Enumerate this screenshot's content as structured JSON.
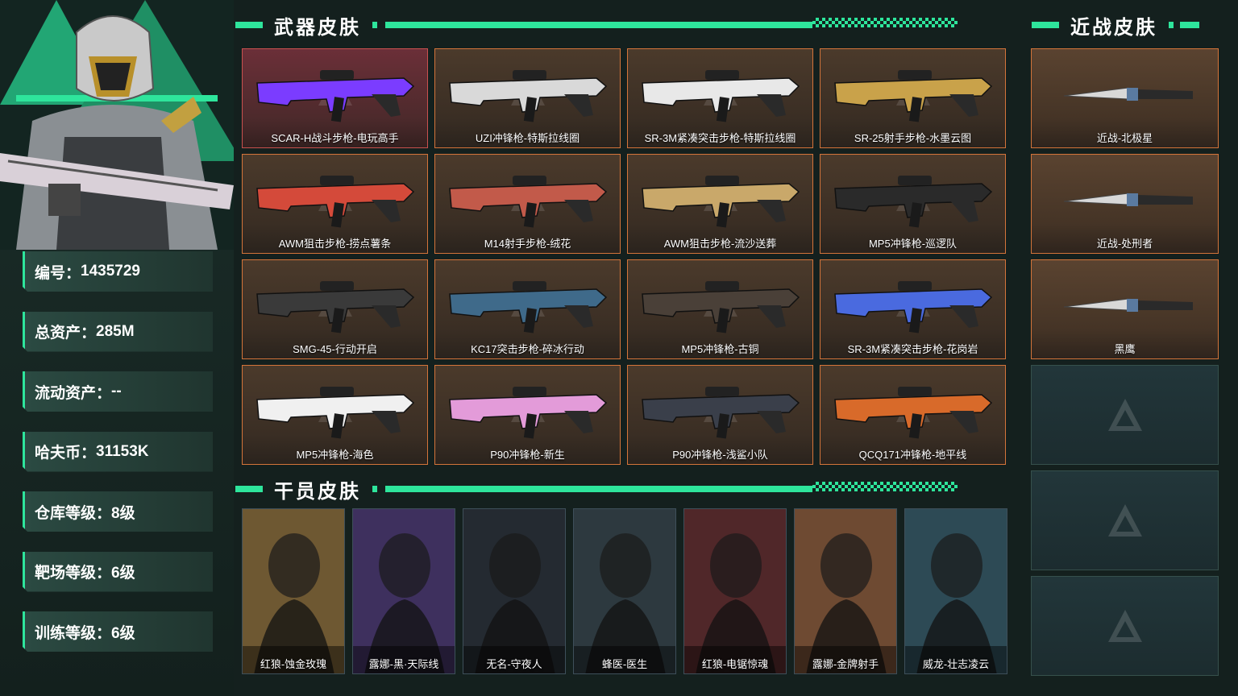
{
  "player": {
    "stats": [
      {
        "key": "编号：",
        "value": "1435729"
      },
      {
        "key": "总资产：",
        "value": "285M"
      },
      {
        "key": "流动资产：",
        "value": "--"
      },
      {
        "key": "哈夫币：",
        "value": "31153K"
      },
      {
        "key": "仓库等级：",
        "value": "8级"
      },
      {
        "key": "靶场等级：",
        "value": "6级"
      },
      {
        "key": "训练等级：",
        "value": "6级"
      }
    ]
  },
  "sections": {
    "weapon_title": "武器皮肤",
    "melee_title": "近战皮肤",
    "operator_title": "干员皮肤"
  },
  "weapons": [
    {
      "name": "SCAR-H战斗步枪-电玩高手",
      "rarity": "red",
      "color": "#7b3cff"
    },
    {
      "name": "UZI冲锋枪-特斯拉线圈",
      "rarity": "orange",
      "color": "#d9d9d9"
    },
    {
      "name": "SR-3M紧凑突击步枪-特斯拉线圈",
      "rarity": "orange",
      "color": "#e8e8e8"
    },
    {
      "name": "SR-25射手步枪-水墨云图",
      "rarity": "orange",
      "color": "#c9a24a"
    },
    {
      "name": "AWM狙击步枪-捞点薯条",
      "rarity": "orange",
      "color": "#d44a3a"
    },
    {
      "name": "M14射手步枪-绒花",
      "rarity": "orange",
      "color": "#c25a4a"
    },
    {
      "name": "AWM狙击步枪-流沙送葬",
      "rarity": "orange",
      "color": "#c9a86a"
    },
    {
      "name": "MP5冲锋枪-巡逻队",
      "rarity": "orange",
      "color": "#2a2a2a"
    },
    {
      "name": "SMG-45-行动开启",
      "rarity": "orange",
      "color": "#3a3a3a"
    },
    {
      "name": "KC17突击步枪-碎冰行动",
      "rarity": "orange",
      "color": "#3f6a8a"
    },
    {
      "name": "MP5冲锋枪-古铜",
      "rarity": "orange",
      "color": "#4a4038"
    },
    {
      "name": "SR-3M紧凑突击步枪-花岗岩",
      "rarity": "orange",
      "color": "#4a6adf"
    },
    {
      "name": "MP5冲锋枪-海色",
      "rarity": "orange",
      "color": "#f0f0f0"
    },
    {
      "name": "P90冲锋枪-新生",
      "rarity": "orange",
      "color": "#e39bd9"
    },
    {
      "name": "P90冲锋枪-浅鲨小队",
      "rarity": "orange",
      "color": "#3a3f4a"
    },
    {
      "name": "QCQ171冲锋枪-地平线",
      "rarity": "orange",
      "color": "#d86a2a"
    }
  ],
  "melee": [
    {
      "name": "近战-北极星",
      "empty": false
    },
    {
      "name": "近战-处刑者",
      "empty": false
    },
    {
      "name": "黑鹰",
      "empty": false
    },
    {
      "name": "",
      "empty": true
    },
    {
      "name": "",
      "empty": true
    },
    {
      "name": "",
      "empty": true
    }
  ],
  "operators": [
    {
      "name": "红狼-蚀金玫瑰",
      "color": "#b0843a"
    },
    {
      "name": "露娜-黑·天际线",
      "color": "#5a3a8a"
    },
    {
      "name": "无名-守夜人",
      "color": "#2a2f38"
    },
    {
      "name": "蜂医-医生",
      "color": "#3a4a52"
    },
    {
      "name": "红狼-电锯惊魂",
      "color": "#7a2a2a"
    },
    {
      "name": "露娜-金牌射手",
      "color": "#b06a3a"
    },
    {
      "name": "威龙-壮志凌云",
      "color": "#3a6a7a"
    }
  ],
  "colors": {
    "accent": "#2ee59c",
    "orange_border": "#d4743a",
    "red_border": "#c9514f"
  }
}
